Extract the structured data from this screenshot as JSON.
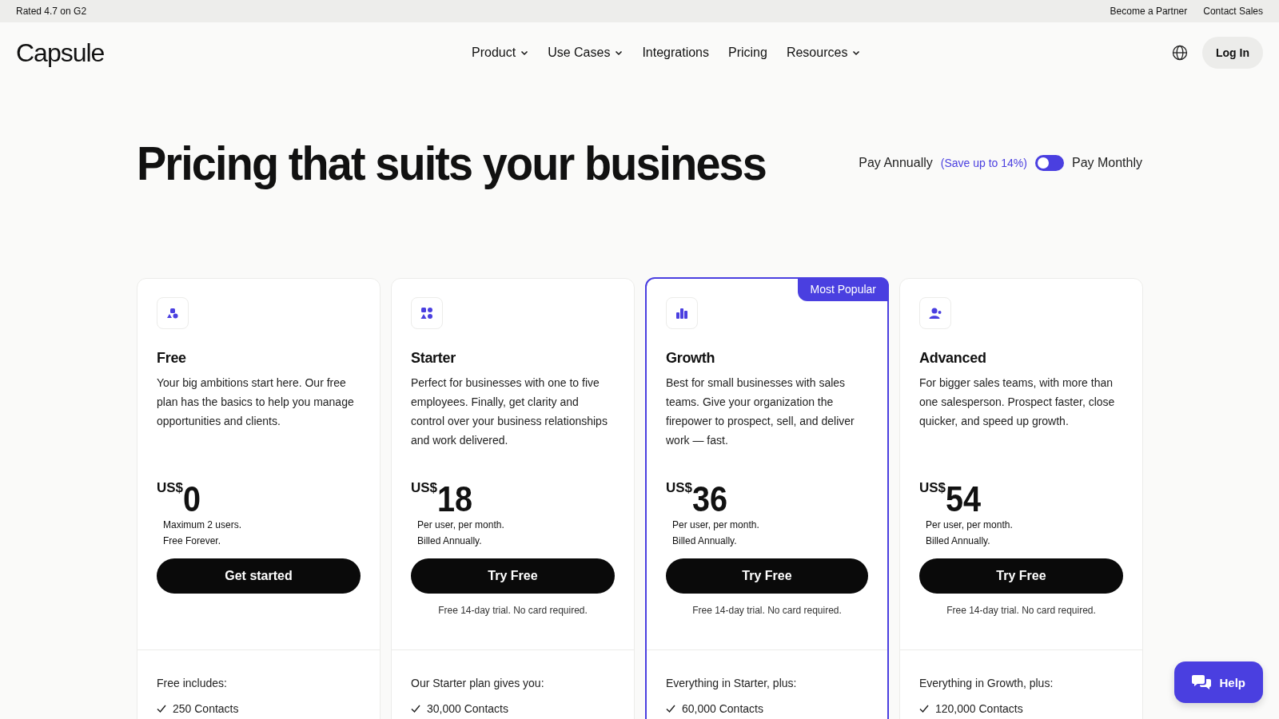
{
  "top_bar": {
    "rating": "Rated 4.7 on G2",
    "links": [
      "Become a Partner",
      "Contact Sales"
    ]
  },
  "nav": {
    "logo": "Capsule",
    "items": [
      {
        "label": "Product",
        "dropdown": true
      },
      {
        "label": "Use Cases",
        "dropdown": true
      },
      {
        "label": "Integrations",
        "dropdown": false
      },
      {
        "label": "Pricing",
        "dropdown": false
      },
      {
        "label": "Resources",
        "dropdown": true
      }
    ],
    "login": "Log In"
  },
  "hero": {
    "title": "Pricing that suits your business",
    "billing": {
      "annual_label": "Pay Annually",
      "savings": "(Save up to 14%)",
      "monthly_label": "Pay Monthly",
      "on": false
    }
  },
  "plans": [
    {
      "kind": "shapes",
      "name": "Free",
      "description": "Your big ambitions start here. Our free plan has the basics to help you manage opportunities and clients.",
      "currency": "US$",
      "price": "0",
      "notes": [
        "Maximum 2 users.",
        "Free Forever."
      ],
      "cta": "Get started",
      "featured": false,
      "features_title": "Free includes:",
      "features": [
        "250 Contacts"
      ]
    },
    {
      "kind": "grid",
      "name": "Starter",
      "description": "Perfect for businesses with one to five employees. Finally, get clarity and control over your business relationships and work delivered.",
      "currency": "US$",
      "price": "18",
      "notes": [
        "Per user, per month.",
        "Billed Annually."
      ],
      "cta": "Try Free",
      "trial": "Free 14-day trial. No card required.",
      "featured": false,
      "features_title": "Our Starter plan gives you:",
      "features": [
        "30,000 Contacts"
      ]
    },
    {
      "kind": "bars",
      "name": "Growth",
      "description": "Best for small businesses with sales teams. Give your organization the firepower to prospect, sell, and deliver work — fast.",
      "currency": "US$",
      "price": "36",
      "notes": [
        "Per user, per month.",
        "Billed Annually."
      ],
      "cta": "Try Free",
      "trial": "Free 14-day trial. No card required.",
      "featured": true,
      "badge": "Most Popular",
      "features_title": "Everything in Starter, plus:",
      "features": [
        "60,000 Contacts"
      ]
    },
    {
      "kind": "person",
      "name": "Advanced",
      "description": "For bigger sales teams, with more than one salesperson. Prospect faster, close quicker, and speed up growth.",
      "currency": "US$",
      "price": "54",
      "notes": [
        "Per user, per month.",
        "Billed Annually."
      ],
      "cta": "Try Free",
      "trial": "Free 14-day trial. No card required.",
      "featured": false,
      "features_title": "Everything in Growth, plus:",
      "features": [
        "120,000 Contacts"
      ]
    }
  ],
  "help_button": "Help"
}
